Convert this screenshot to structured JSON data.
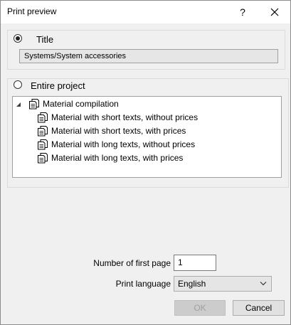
{
  "window": {
    "title": "Print preview",
    "help_label": "?"
  },
  "options": {
    "title_option": {
      "label": "Title",
      "selected": true,
      "value": "Systems/System accessories"
    },
    "project_option": {
      "label": "Entire project",
      "selected": false
    }
  },
  "tree": {
    "root": {
      "label": "Material compilation",
      "expanded": true
    },
    "items": [
      {
        "label": "Material with short texts, without prices"
      },
      {
        "label": "Material with short texts, with prices"
      },
      {
        "label": "Material with long texts, without prices"
      },
      {
        "label": "Material with long texts, with prices"
      }
    ]
  },
  "form": {
    "first_page_label": "Number of first page",
    "first_page_value": "1",
    "language_label": "Print language",
    "language_value": "English"
  },
  "buttons": {
    "ok_label": "OK",
    "cancel_label": "Cancel"
  }
}
